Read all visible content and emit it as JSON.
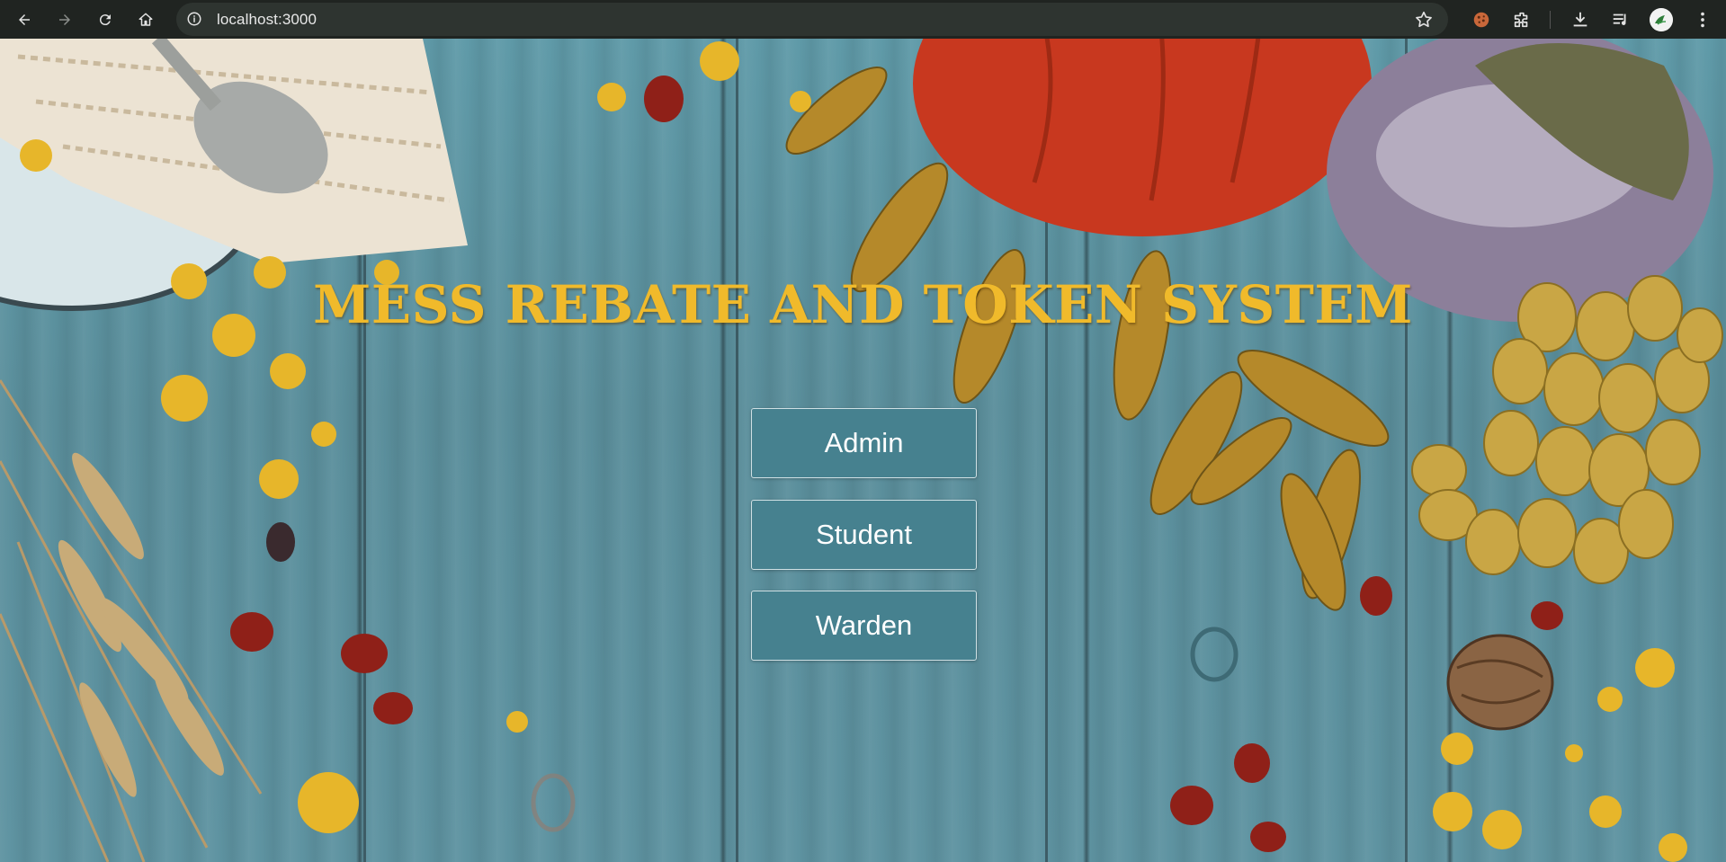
{
  "browser": {
    "url": "localhost:3000"
  },
  "page": {
    "title": "MESS REBATE AND TOKEN SYSTEM",
    "buttons": [
      {
        "label": "Admin"
      },
      {
        "label": "Student"
      },
      {
        "label": "Warden"
      }
    ]
  },
  "colors": {
    "title": "#f0ba2b",
    "button_bg": "#46818f",
    "button_text": "#ffffff",
    "chrome_bg": "#202421"
  },
  "icons": [
    "back-arrow-icon",
    "forward-arrow-icon",
    "reload-icon",
    "home-icon",
    "site-info-icon",
    "bookmark-star-icon",
    "cookie-extension-icon",
    "extensions-puzzle-icon",
    "download-icon",
    "media-queue-icon",
    "profile-avatar-icon",
    "kebab-menu-icon"
  ]
}
